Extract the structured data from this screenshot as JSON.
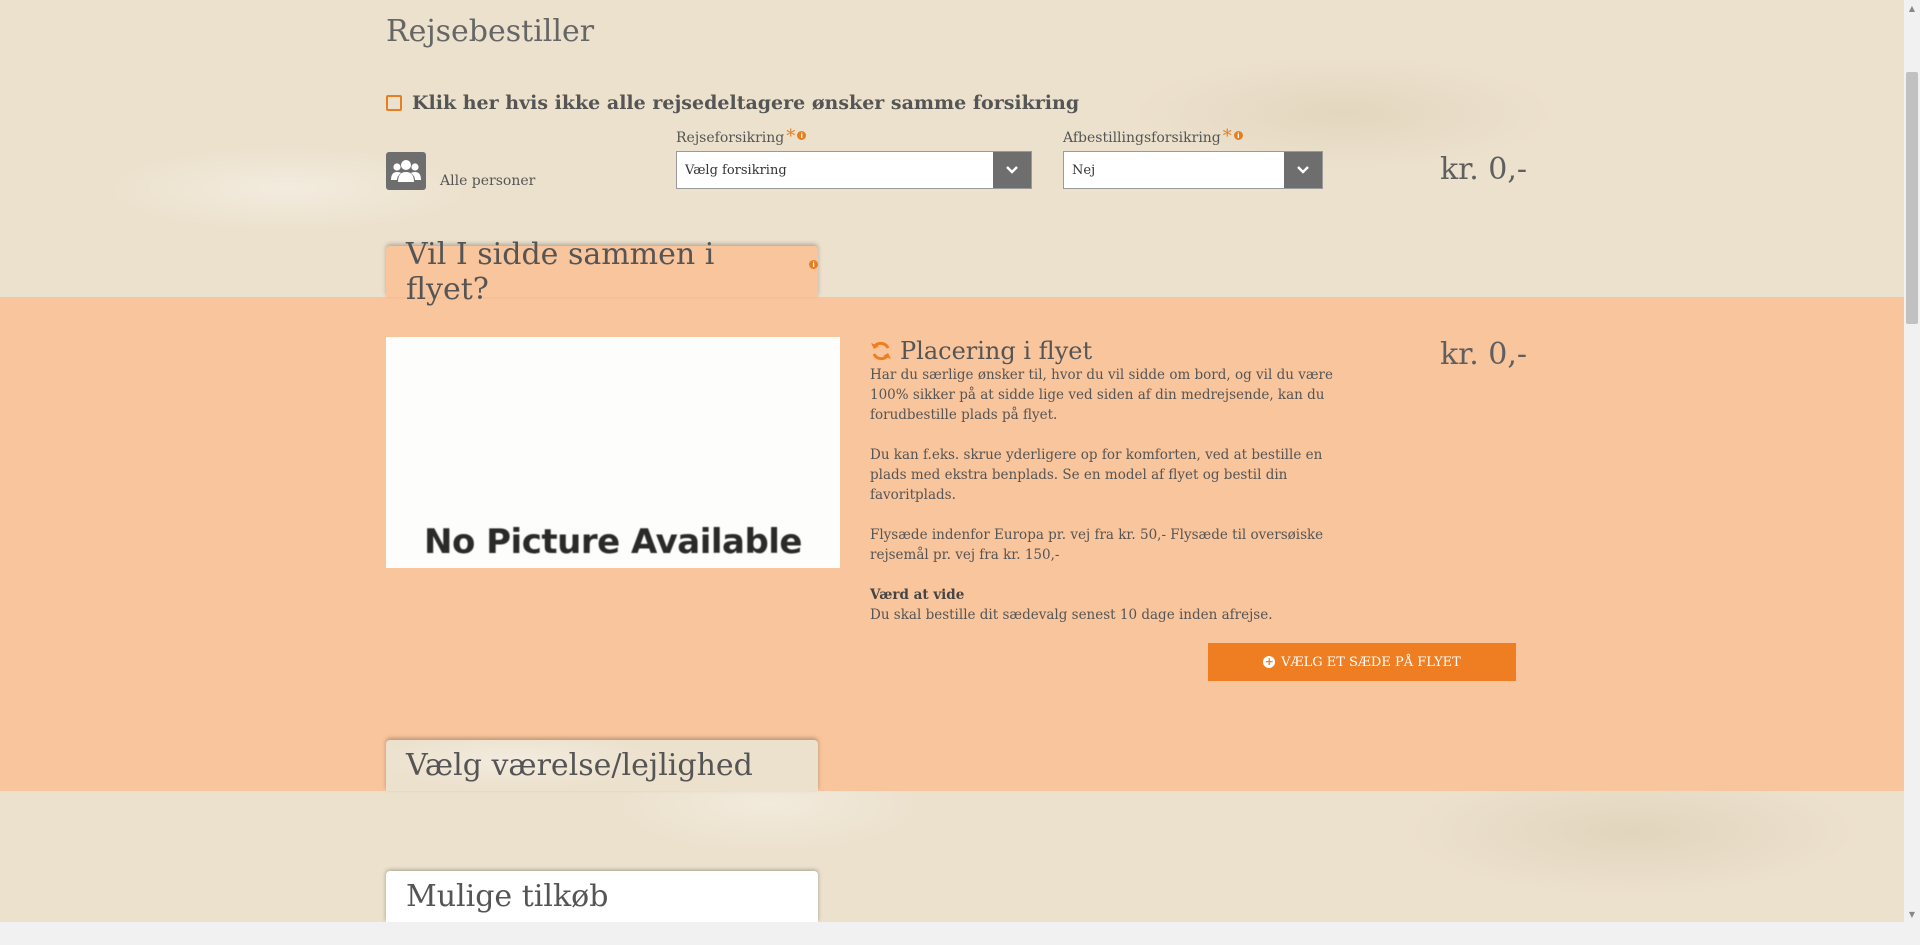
{
  "page": {
    "title": "Rejsebestiller"
  },
  "insurance": {
    "checkbox_label": "Klik her hvis ikke alle rejsedeltagere ønsker samme forsikring",
    "persons_label": "Alle personer",
    "travel_insurance": {
      "label": "Rejseforsikring",
      "required_mark": "*",
      "info_mark": "i",
      "selected": "Vælg forsikring"
    },
    "cancellation_insurance": {
      "label": "Afbestillingsforsikring",
      "required_mark": "*",
      "info_mark": "i",
      "selected": "Nej"
    },
    "price": "kr. 0,-"
  },
  "seating": {
    "tab_title": "Vil I sidde sammen i flyet?",
    "tab_info_mark": "i",
    "image_text": "No Picture Available",
    "heading": "Placering i flyet",
    "paragraphs": [
      "Har du særlige ønsker til, hvor du vil sidde om bord, og vil du være 100% sikker på at sidde lige ved siden af din medrejsende, kan du forudbestille plads på flyet.",
      "Du kan f.eks. skrue yderligere op for komforten, ved at bestille en plads med ekstra benplads. Se en model af flyet og bestil din favoritplads.",
      "Flysæde indenfor Europa pr. vej fra kr. 50,- Flysæde til oversøiske rejsemål pr. vej fra kr. 150,-"
    ],
    "note_title": "Værd at vide",
    "note_text": "Du skal bestille dit sædevalg senest 10 dage inden afrejse.",
    "price": "kr. 0,-",
    "button_label": "VÆLG ET SÆDE PÅ FLYET"
  },
  "room": {
    "tab_title": "Vælg værelse/lejlighed"
  },
  "addons": {
    "tab_title": "Mulige tilkøb"
  },
  "colors": {
    "accent": "#ef7e22",
    "peach_band": "#f9c59c",
    "parchment": "#ece1cd",
    "dark_gray": "#6e6e6e"
  },
  "icons": [
    "users-group-icon",
    "chevron-down-icon",
    "refresh-icon",
    "plus-circle-icon",
    "info-icon"
  ]
}
